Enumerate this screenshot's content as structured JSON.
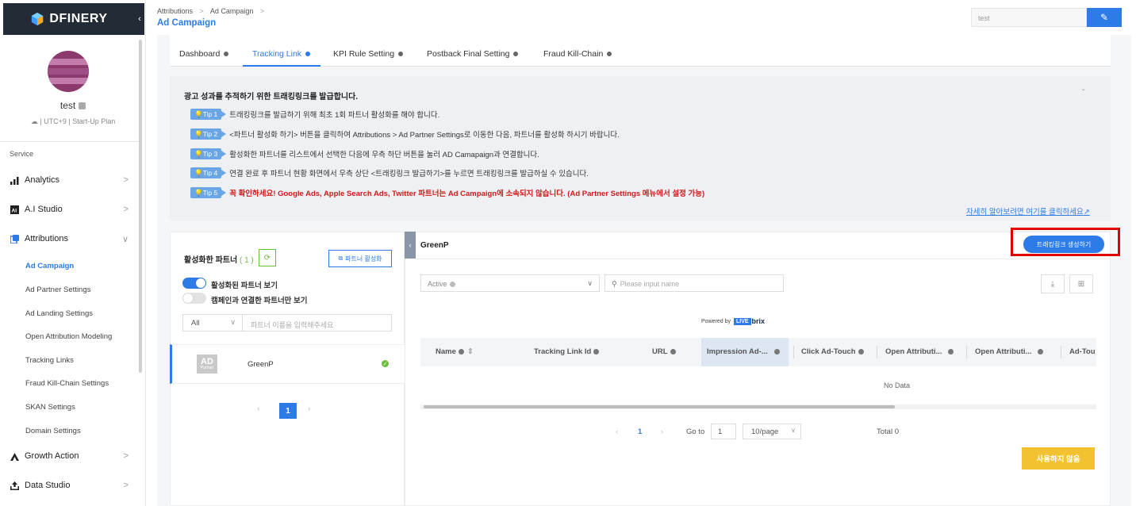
{
  "sidebar": {
    "logo_text": "DFINERY",
    "collapse_icon": "‹",
    "user": {
      "name": "test",
      "meta": "| UTC+9 | Start-Up Plan"
    },
    "service_label": "Service",
    "items": [
      {
        "label": "Analytics",
        "icon": "bar-chart-icon"
      },
      {
        "label": "A.I Studio",
        "icon": "ai-icon"
      },
      {
        "label": "Attributions",
        "icon": "attribution-icon"
      },
      {
        "label": "Growth Action",
        "icon": "growth-icon"
      },
      {
        "label": "Data Studio",
        "icon": "upload-icon"
      }
    ],
    "sub_items": [
      {
        "label": "Ad Campaign"
      },
      {
        "label": "Ad Partner Settings"
      },
      {
        "label": "Ad Landing Settings"
      },
      {
        "label": "Open Attribution Modeling"
      },
      {
        "label": "Tracking Links"
      },
      {
        "label": "Fraud Kill-Chain Settings"
      },
      {
        "label": "SKAN Settings"
      },
      {
        "label": "Domain Settings"
      }
    ]
  },
  "header": {
    "breadcrumb": [
      "Attributions",
      "Ad Campaign"
    ],
    "crumb_sep": ">",
    "title": "Ad Campaign",
    "search_value": "test",
    "edit_icon": "✎"
  },
  "tabs": [
    {
      "label": "Dashboard"
    },
    {
      "label": "Tracking Link"
    },
    {
      "label": "KPI Rule Setting"
    },
    {
      "label": "Postback Final Setting"
    },
    {
      "label": "Fraud Kill-Chain"
    }
  ],
  "info": {
    "title": "광고 성과를 추적하기 위한 트래킹링크를 발급합니다.",
    "tips": [
      {
        "badge": "Tip 1",
        "text": "트래킹링크를 발급하기 위해 최초 1회 파트너 활성화를 해야 합니다."
      },
      {
        "badge": "Tip 2",
        "text": "<파트너 활성화 하기> 버튼을 클릭하여 Attributions > Ad Partner Settings로 이동한 다음, 파트너를 활성화 하시기 바랍니다."
      },
      {
        "badge": "Tip 3",
        "text": "활성화한 파트너를 리스트에서 선택한 다음에 우측 하단 버튼을 눌러 AD Camapaign과 연결합니다."
      },
      {
        "badge": "Tip 4",
        "text": "연결 완료 후 파트너 현황 화면에서 우측 상단 <트래킹링크 발급하기>를 누르면 트래킹링크를 발급하실 수 있습니다."
      },
      {
        "badge": "Tip 5",
        "text": "꼭 확인하세요! Google Ads, Apple Search Ads, Twitter 파트너는 Ad Campaign에 소속되지 않습니다. (Ad Partner Settings 메뉴에서 설정 가능)"
      }
    ],
    "link": "자세히 알아보려면 여기를 클릭하세요"
  },
  "partners": {
    "title": "활성화한 파트너",
    "count": "( 1 )",
    "activate_button": "파트너 활성화",
    "toggle1": "활성화된 파트너 보기",
    "toggle2": "캠페인과 연결한 파트너만 보기",
    "filter_value": "All",
    "search_placeholder": "파트너 이름을 입력해주세요",
    "list": [
      {
        "name": "GreenP",
        "logo": "AD",
        "logo_sub": "Partner"
      }
    ],
    "page": "1"
  },
  "detail": {
    "title": "GreenP",
    "create_button": "트래킹링크 생성하기",
    "status_value": "Active",
    "name_placeholder": "Please input name",
    "powered_by": "Powered by",
    "brand_live": "LIVE",
    "brand_brix": "brix",
    "columns": [
      "Name",
      "Tracking Link Id",
      "URL",
      "Impression Ad-...",
      "Click Ad-Touch",
      "Open Attributi...",
      "Open Attributi...",
      "Ad-Tou"
    ],
    "no_data": "No Data",
    "pager": {
      "page": "1",
      "goto_label": "Go to",
      "goto_value": "1",
      "per_page": "10/page",
      "total": "Total 0"
    },
    "unused_button": "사용하지 않음"
  },
  "colors": {
    "accent": "#2d7be6",
    "sidebar_dark": "#232b36",
    "warn": "#d11a1a",
    "green": "#6cbf3b",
    "yellow": "#f2c230",
    "highlight": "#e00000"
  }
}
